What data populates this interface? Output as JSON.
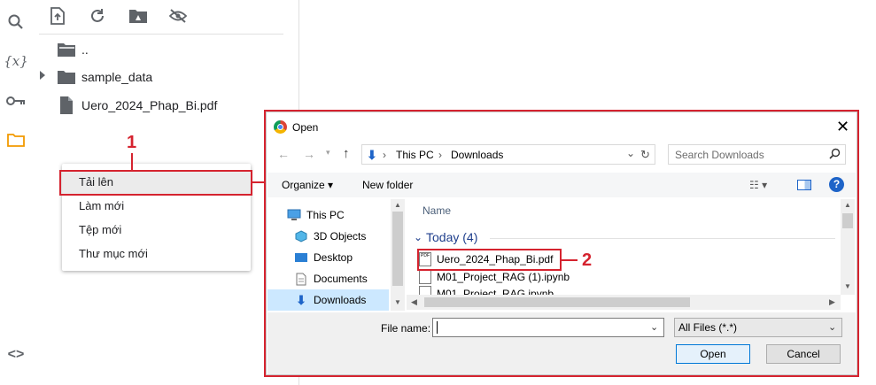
{
  "file_panel": {
    "tree": [
      {
        "name": ".."
      },
      {
        "name": "sample_data"
      },
      {
        "name": "Uero_2024_Phap_Bi.pdf"
      }
    ]
  },
  "context_menu": {
    "items": [
      "Tải lên",
      "Làm mới",
      "Tệp mới",
      "Thư mục mới"
    ]
  },
  "callouts": {
    "one": "1",
    "two": "2"
  },
  "dialog": {
    "title": "Open",
    "breadcrumb": [
      "This PC",
      "Downloads"
    ],
    "search_placeholder": "Search Downloads",
    "organize_label": "Organize",
    "new_folder_label": "New folder",
    "nav_items": [
      "This PC",
      "3D Objects",
      "Desktop",
      "Documents",
      "Downloads"
    ],
    "column_name": "Name",
    "group_label": "Today (4)",
    "files": [
      "Uero_2024_Phap_Bi.pdf",
      "M01_Project_RAG (1).ipynb",
      "M01_Project_RAG.ipynb"
    ],
    "file_name_label": "File name:",
    "file_name_value": "",
    "file_type": "All Files (*.*)",
    "open_label": "Open",
    "cancel_label": "Cancel"
  },
  "colors": {
    "accent_red": "#d5232f",
    "folder_orange": "#f29900",
    "win_blue": "#1e64c8"
  }
}
